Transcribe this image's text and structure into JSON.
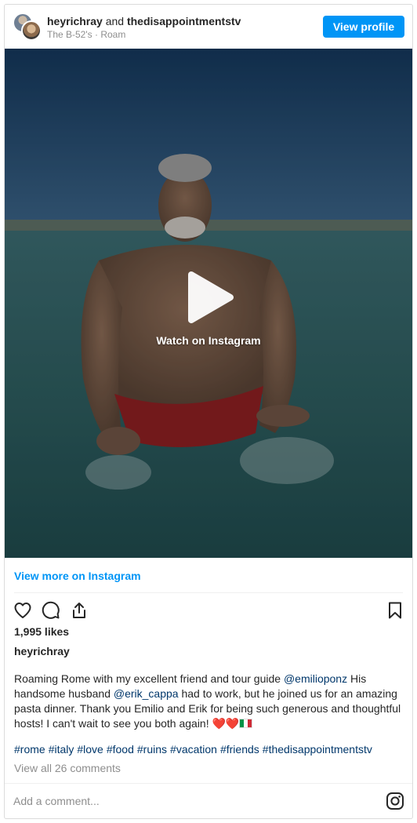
{
  "header": {
    "user1": "heyrichray",
    "joiner": "and",
    "user2": "thedisappointmentstv",
    "subline": "The B-52's · Roam",
    "view_profile_label": "View profile"
  },
  "media": {
    "overlay_label": "Watch on Instagram",
    "play_icon": "play-icon"
  },
  "footer": {
    "view_more_label": "View more on Instagram",
    "likes": "1,995 likes",
    "author": "heyrichray",
    "caption": {
      "part1": "Roaming Rome with my excellent friend and tour guide ",
      "mention1": "@emilioponz",
      "part2": " His handsome husband ",
      "mention2": "@erik_cappa",
      "part3": " had to work, but he joined us for an amazing pasta dinner. Thank you Emilio and Erik for being such generous and thoughtful hosts! I can't wait to see you both again! ",
      "emoji_hearts": "❤️❤️"
    },
    "hashtags": [
      "#rome",
      "#italy",
      "#love",
      "#food",
      "#ruins",
      "#vacation",
      "#friends",
      "#thedisappointmentstv"
    ],
    "comments_link": "View all 26 comments",
    "comment_placeholder": "Add a comment..."
  },
  "icons": {
    "like": "heart-icon",
    "comment": "comment-icon",
    "share": "share-icon",
    "save": "bookmark-icon",
    "instagram": "instagram-icon"
  },
  "colors": {
    "accent": "#0095f6",
    "link": "#00376b",
    "muted": "#8e8e8e",
    "text": "#262626"
  }
}
